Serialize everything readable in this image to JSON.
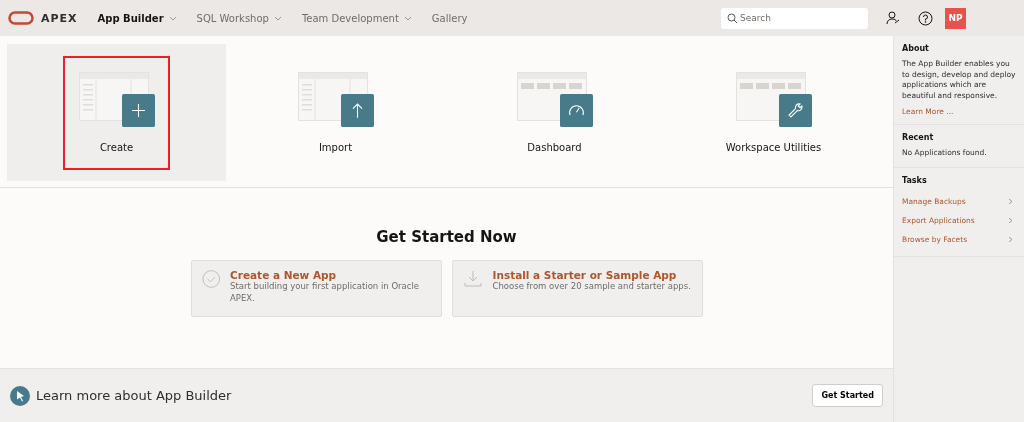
{
  "header": {
    "logo": "APEX",
    "nav": [
      {
        "label": "App Builder",
        "selected": true,
        "dropdown": true
      },
      {
        "label": "SQL Workshop",
        "selected": false,
        "dropdown": true
      },
      {
        "label": "Team Development",
        "selected": false,
        "dropdown": true
      },
      {
        "label": "Gallery",
        "selected": false,
        "dropdown": false
      }
    ],
    "search": {
      "placeholder": "Search"
    },
    "avatar": "NP"
  },
  "tiles": [
    {
      "kind": "create",
      "label": "Create",
      "selected": true,
      "highlighted": true
    },
    {
      "kind": "import",
      "label": "Import",
      "selected": false,
      "highlighted": false
    },
    {
      "kind": "dashboard",
      "label": "Dashboard",
      "selected": false,
      "highlighted": false
    },
    {
      "kind": "utilities",
      "label": "Workspace Utilities",
      "selected": false,
      "highlighted": false
    }
  ],
  "get_started": {
    "title": "Get Started Now",
    "cards": [
      {
        "kind": "check",
        "title": "Create a New App",
        "text": "Start building your first application in Oracle APEX."
      },
      {
        "kind": "download",
        "title": "Install a Starter or Sample App",
        "text": "Choose from over 20 sample and starter apps."
      }
    ]
  },
  "learn_bar": {
    "text": "Learn more about App Builder",
    "button": "Get Started"
  },
  "sidebar": {
    "about": {
      "title": "About",
      "text": "The App Builder enables you to design, develop and deploy applications which are beautiful and responsive.",
      "link": "Learn More ..."
    },
    "recent": {
      "title": "Recent",
      "text": "No Applications found."
    },
    "tasks": {
      "title": "Tasks",
      "items": [
        "Manage Backups",
        "Export Applications",
        "Browse by Facets"
      ]
    }
  }
}
